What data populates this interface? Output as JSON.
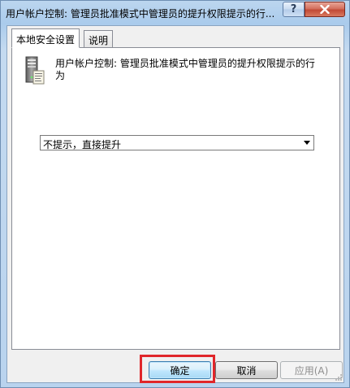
{
  "window": {
    "title": "用户帐户控制: 管理员批准模式中管理员的提升权限提示的行...",
    "help_label": "?"
  },
  "tabs": [
    {
      "label": "本地安全设置",
      "active": true
    },
    {
      "label": "说明",
      "active": false
    }
  ],
  "policy": {
    "icon": "server-policy-icon",
    "description": "用户帐户控制: 管理员批准模式中管理员的提升权限提示的行为"
  },
  "dropdown": {
    "selected": "不提示，直接提升"
  },
  "buttons": {
    "ok": "确定",
    "cancel": "取消",
    "apply": "应用(A)"
  },
  "colors": {
    "highlight": "#e0262a",
    "close_button": "#c24a35",
    "default_button": "#3c7fb1"
  }
}
